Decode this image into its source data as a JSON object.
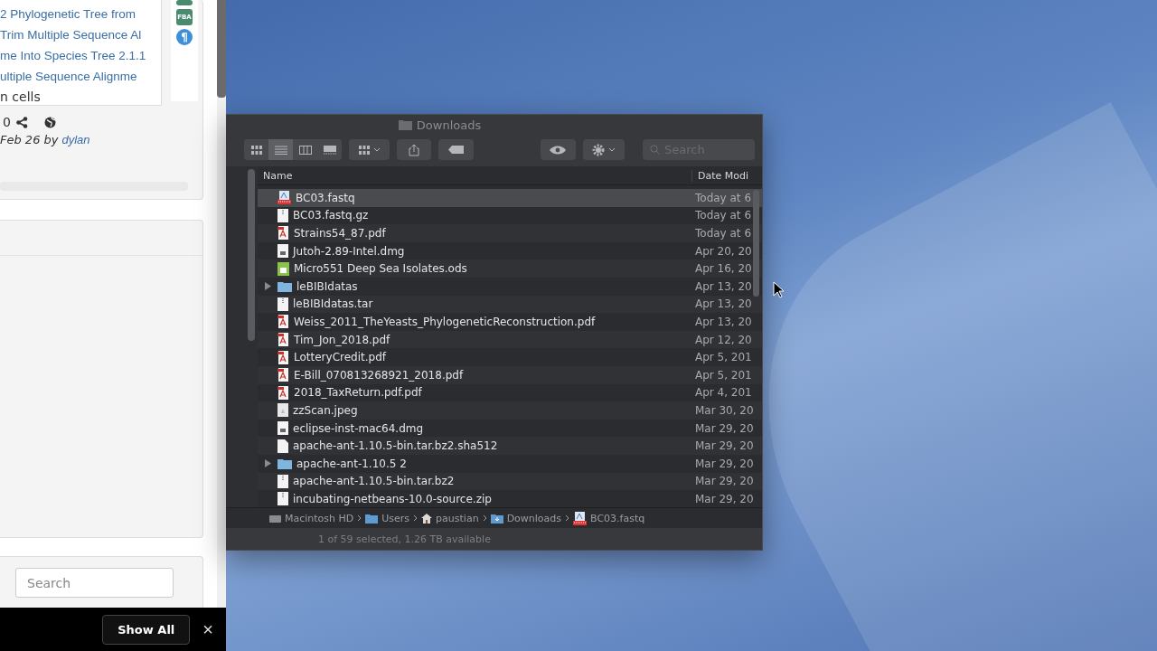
{
  "browser": {
    "badges": [
      {
        "kind": "cut",
        "color": "#4a8a6e"
      },
      {
        "kind": "tag",
        "label": "FBA",
        "color": "#4a8a6e"
      },
      {
        "kind": "round",
        "label": "¶",
        "color": "#3d8fd9"
      }
    ],
    "links": [
      "2 Phylogenetic Tree from",
      "Trim Multiple Sequence Al",
      "me Into Species Tree 2.1.1",
      "ultiple Sequence Alignme"
    ],
    "note": "n cells",
    "share_count": "0",
    "byline_prefix": "Feb 26 by",
    "author": "dylan",
    "search": {
      "placeholder": "Search"
    },
    "download_bar": {
      "show_all": "Show All",
      "close": "×"
    }
  },
  "finder": {
    "title": "Downloads",
    "view_modes": [
      {
        "kind": "icons",
        "selected": false
      },
      {
        "kind": "list",
        "selected": true
      },
      {
        "kind": "columns",
        "selected": false
      },
      {
        "kind": "gallery",
        "selected": false
      }
    ],
    "search": {
      "placeholder": "Search"
    },
    "columns": [
      "Name",
      "Date Modi"
    ],
    "rows": [
      {
        "name": "BC03.fastq",
        "date": "Today at 6",
        "kind": "fastq",
        "selected": true
      },
      {
        "name": "BC03.fastq.gz",
        "date": "Today at 6",
        "kind": "archive",
        "selected": false
      },
      {
        "name": "Strains54_87.pdf",
        "date": "Today at 6",
        "kind": "pdf",
        "selected": false
      },
      {
        "name": "Jutoh-2.89-Intel.dmg",
        "date": "Apr 20, 20",
        "kind": "dmg",
        "selected": false
      },
      {
        "name": "Micro551 Deep Sea Isolates.ods",
        "date": "Apr 16, 20",
        "kind": "ods",
        "selected": false
      },
      {
        "name": "leBIBIdatas",
        "date": "Apr 13, 20",
        "kind": "folder",
        "selected": false,
        "expanded": false
      },
      {
        "name": "leBIBIdatas.tar",
        "date": "Apr 13, 20",
        "kind": "archive",
        "selected": false
      },
      {
        "name": "Weiss_2011_TheYeasts_PhylogeneticReconstruction.pdf",
        "date": "Apr 13, 20",
        "kind": "pdf",
        "selected": false
      },
      {
        "name": "Tim_Jon_2018.pdf",
        "date": "Apr 12, 20",
        "kind": "pdf",
        "selected": false
      },
      {
        "name": "LotteryCredit.pdf",
        "date": "Apr 5, 201",
        "kind": "pdf",
        "selected": false
      },
      {
        "name": "E-Bill_070813268921_2018.pdf",
        "date": "Apr 5, 201",
        "kind": "pdf",
        "selected": false
      },
      {
        "name": "2018_TaxReturn.pdf.pdf",
        "date": "Apr 4, 201",
        "kind": "pdf",
        "selected": false
      },
      {
        "name": "zzScan.jpeg",
        "date": "Mar 30, 20",
        "kind": "image",
        "selected": false
      },
      {
        "name": "eclipse-inst-mac64.dmg",
        "date": "Mar 29, 20",
        "kind": "dmg",
        "selected": false
      },
      {
        "name": "apache-ant-1.10.5-bin.tar.bz2.sha512",
        "date": "Mar 29, 20",
        "kind": "file",
        "selected": false
      },
      {
        "name": "apache-ant-1.10.5 2",
        "date": "Mar 29, 20",
        "kind": "folder",
        "selected": false,
        "expanded": false
      },
      {
        "name": "apache-ant-1.10.5-bin.tar.bz2",
        "date": "Mar 29, 20",
        "kind": "archive",
        "selected": false
      },
      {
        "name": "incubating-netbeans-10.0-source.zip",
        "date": "Mar 29, 20",
        "kind": "archive",
        "selected": false
      }
    ],
    "path": [
      {
        "label": "Macintosh HD",
        "kind": "disk"
      },
      {
        "label": "Users",
        "kind": "folder"
      },
      {
        "label": "paustian",
        "kind": "home"
      },
      {
        "label": "Downloads",
        "kind": "downloads"
      },
      {
        "label": "BC03.fastq",
        "kind": "fastq"
      }
    ],
    "status": "1 of 59 selected, 1.26 TB available"
  }
}
